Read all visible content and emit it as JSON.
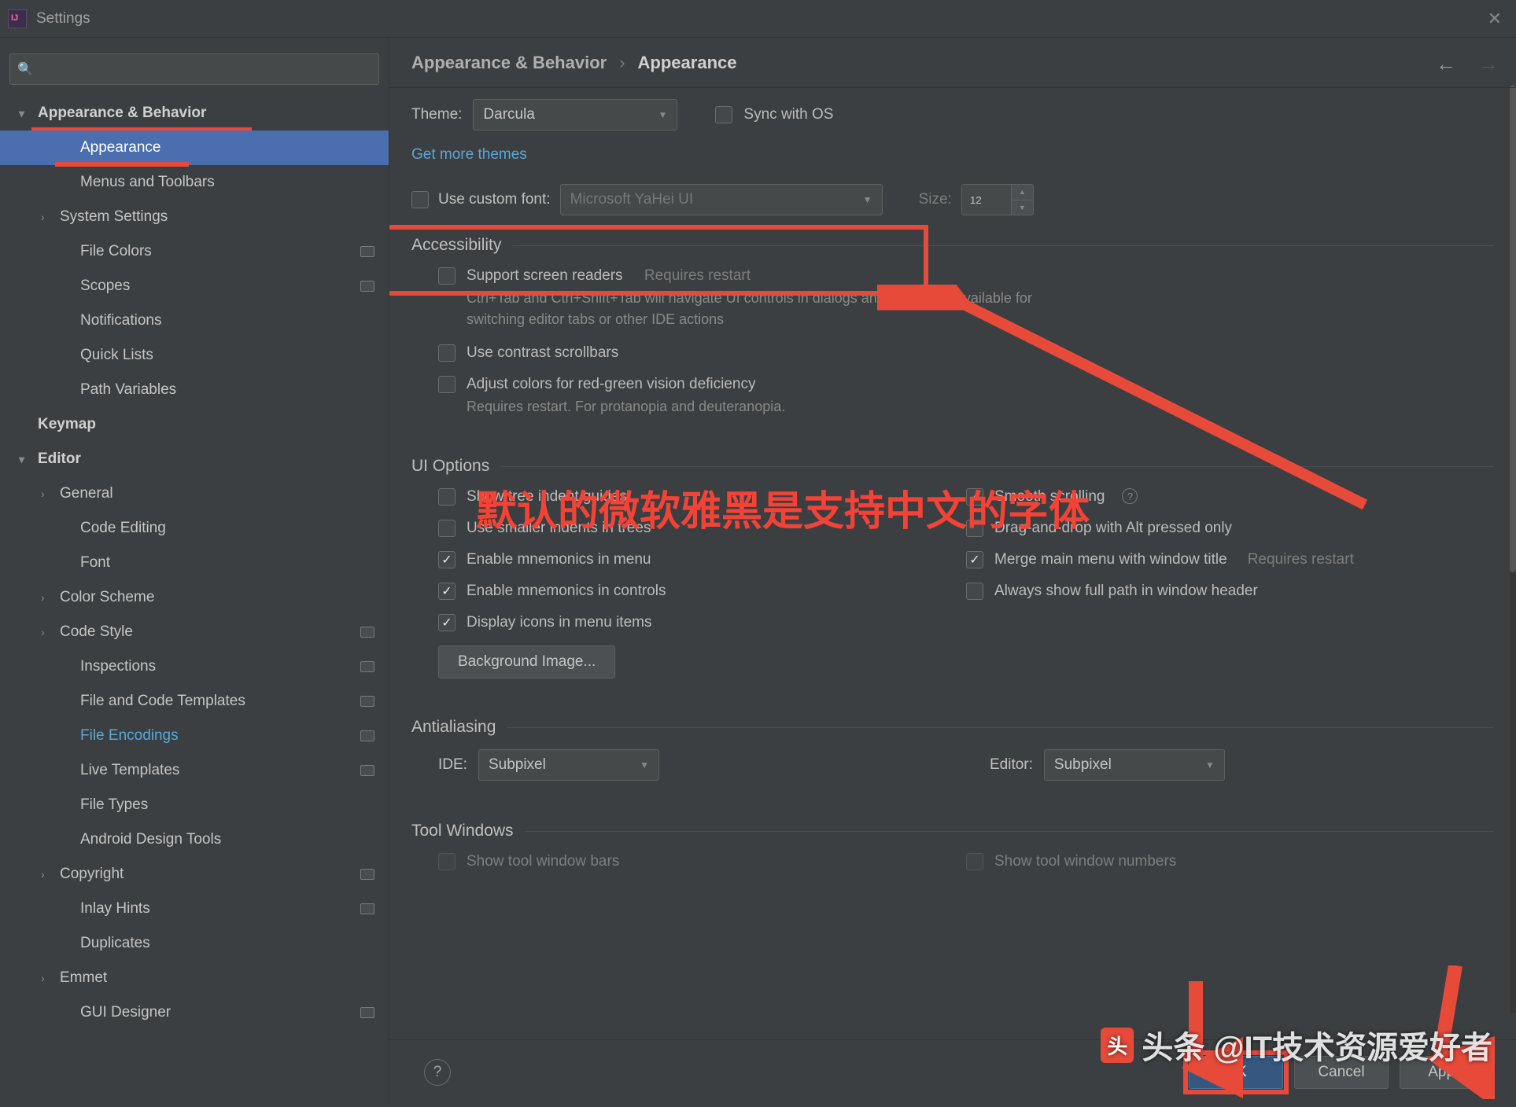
{
  "window": {
    "title": "Settings"
  },
  "search": {
    "placeholder": ""
  },
  "sidebar": {
    "items": [
      {
        "label": "Appearance & Behavior",
        "depth": 0,
        "chev": "▾",
        "bold": true,
        "redline": true
      },
      {
        "label": "Appearance",
        "depth": 2,
        "selected": true,
        "redline": true
      },
      {
        "label": "Menus and Toolbars",
        "depth": 2
      },
      {
        "label": "System Settings",
        "depth": 1,
        "chev": "›"
      },
      {
        "label": "File Colors",
        "depth": 2,
        "badge": true
      },
      {
        "label": "Scopes",
        "depth": 2,
        "badge": true
      },
      {
        "label": "Notifications",
        "depth": 2
      },
      {
        "label": "Quick Lists",
        "depth": 2
      },
      {
        "label": "Path Variables",
        "depth": 2
      },
      {
        "label": "Keymap",
        "depth": 0,
        "bold": true
      },
      {
        "label": "Editor",
        "depth": 0,
        "chev": "▾",
        "bold": true
      },
      {
        "label": "General",
        "depth": 1,
        "chev": "›"
      },
      {
        "label": "Code Editing",
        "depth": 2
      },
      {
        "label": "Font",
        "depth": 2
      },
      {
        "label": "Color Scheme",
        "depth": 1,
        "chev": "›"
      },
      {
        "label": "Code Style",
        "depth": 1,
        "chev": "›",
        "badge": true
      },
      {
        "label": "Inspections",
        "depth": 2,
        "badge": true
      },
      {
        "label": "File and Code Templates",
        "depth": 2,
        "badge": true
      },
      {
        "label": "File Encodings",
        "depth": 2,
        "badge": true,
        "link": true
      },
      {
        "label": "Live Templates",
        "depth": 2,
        "badge": true
      },
      {
        "label": "File Types",
        "depth": 2
      },
      {
        "label": "Android Design Tools",
        "depth": 2
      },
      {
        "label": "Copyright",
        "depth": 1,
        "chev": "›",
        "badge": true
      },
      {
        "label": "Inlay Hints",
        "depth": 2,
        "badge": true
      },
      {
        "label": "Duplicates",
        "depth": 2
      },
      {
        "label": "Emmet",
        "depth": 1,
        "chev": "›"
      },
      {
        "label": "GUI Designer",
        "depth": 2,
        "badge": true
      }
    ]
  },
  "breadcrumb": {
    "parent": "Appearance & Behavior",
    "current": "Appearance"
  },
  "theme": {
    "label": "Theme:",
    "value": "Darcula",
    "sync": "Sync with OS",
    "get_more": "Get more themes"
  },
  "font": {
    "use_custom": "Use custom font:",
    "font_value": "Microsoft YaHei UI",
    "size_label": "Size:",
    "size_value": "12"
  },
  "accessibility": {
    "title": "Accessibility",
    "screen_readers": "Support screen readers",
    "requires_restart": "Requires restart",
    "screen_readers_sub": "Ctrl+Tab and Ctrl+Shift+Tab will navigate UI controls in dialogs and will not be available for switching editor tabs or other IDE actions",
    "contrast": "Use contrast scrollbars",
    "color_def": "Adjust colors for red-green vision deficiency",
    "color_def_sub": "Requires restart. For protanopia and deuteranopia."
  },
  "ui_options": {
    "title": "UI Options",
    "tree_guides": "Show tree indent guides",
    "smaller_indents": "Use smaller indents in trees",
    "mnemonics_menu": "Enable mnemonics in menu",
    "mnemonics_controls": "Enable mnemonics in controls",
    "display_icons": "Display icons in menu items",
    "smooth_scroll": "Smooth scrolling",
    "drag_drop": "Drag-and-drop with Alt pressed only",
    "merge_menu": "Merge main menu with window title",
    "full_path": "Always show full path in window header",
    "background_image": "Background Image..."
  },
  "antialiasing": {
    "title": "Antialiasing",
    "ide_label": "IDE:",
    "ide_value": "Subpixel",
    "editor_label": "Editor:",
    "editor_value": "Subpixel"
  },
  "tool_windows": {
    "title": "Tool Windows"
  },
  "footer": {
    "ok": "OK",
    "cancel": "Cancel",
    "apply": "Apply"
  },
  "annotation": {
    "text": "默认的微软雅黑是支持中文的字体"
  },
  "watermark": {
    "text": "头条 @IT技术资源爱好者"
  }
}
